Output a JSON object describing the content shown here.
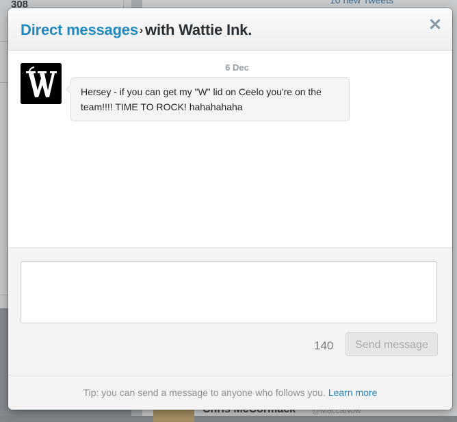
{
  "background": {
    "count_label": "308",
    "new_tweets": "10 new Tweets",
    "bottom_name": "Chris McCormack",
    "bottom_handle": "@MaccaNow"
  },
  "modal": {
    "title_link": "Direct messages",
    "title_separator": "›",
    "title_rest": "with Wattie Ink.",
    "close_icon": "✕"
  },
  "conversation": {
    "date": "6 Dec",
    "sender_avatar": "Wattie Ink. logo",
    "message": "Hersey - if you can get my \"W\" lid on Ceelo you're on the team!!!! TIME TO ROCK! hahahahaha"
  },
  "compose": {
    "value": "",
    "char_count": "140",
    "send_label": "Send message"
  },
  "footer": {
    "tip": "Tip: you can send a message to anyone who follows you.",
    "learn_more": "Learn more"
  },
  "colors": {
    "link": "#1f88be",
    "overlay": "#7f8488"
  }
}
